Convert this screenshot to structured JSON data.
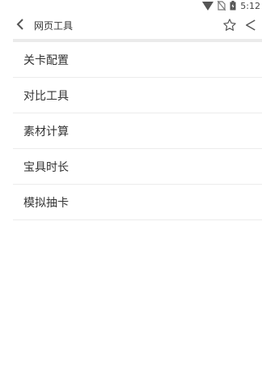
{
  "status_bar": {
    "time": "5:12",
    "icons": [
      "wifi-icon",
      "no-sim-icon",
      "battery-icon"
    ]
  },
  "toolbar": {
    "title": "网页工具",
    "back_icon": "back-arrow-icon",
    "star_icon": "star-outline-icon",
    "share_icon": "share-icon"
  },
  "list": {
    "items": [
      {
        "label": "关卡配置"
      },
      {
        "label": "对比工具"
      },
      {
        "label": "素材计算"
      },
      {
        "label": "宝具时长"
      },
      {
        "label": "模拟抽卡"
      }
    ]
  }
}
